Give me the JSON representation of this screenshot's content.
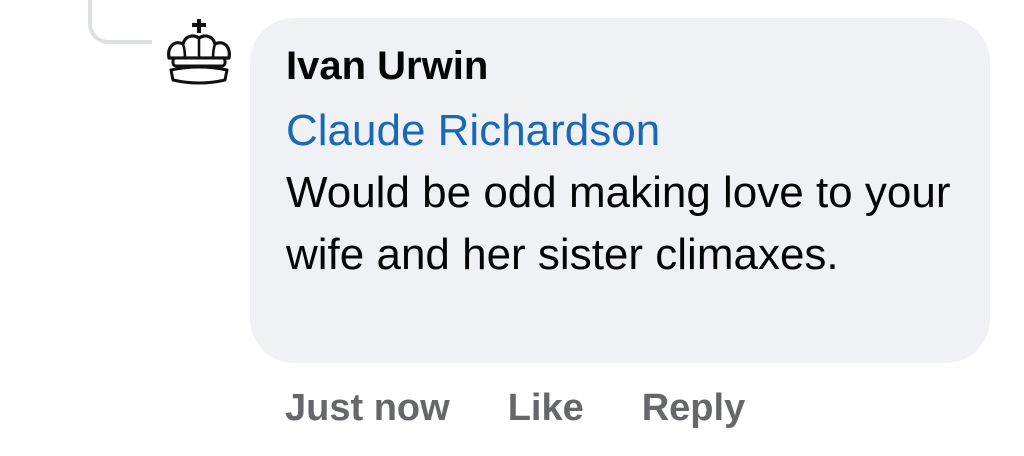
{
  "comment": {
    "author": "Ivan Urwin",
    "mention": "Claude Richardson",
    "text": "Would be odd making love to your wife and her sister climaxes.",
    "avatar_icon": "crown-icon"
  },
  "actions": {
    "timestamp": "Just now",
    "like_label": "Like",
    "reply_label": "Reply"
  },
  "colors": {
    "bubble_bg": "#eff1f5",
    "mention": "#1968b8",
    "meta_text": "#65676b",
    "thread_line": "#dcdfe4"
  }
}
